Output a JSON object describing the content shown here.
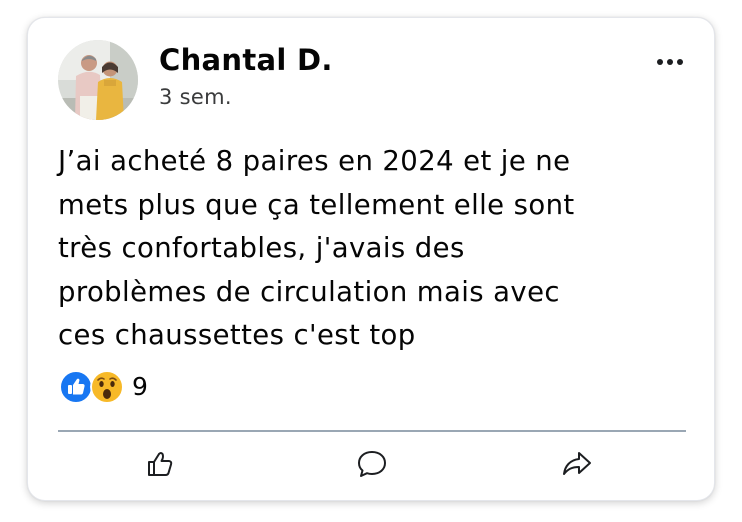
{
  "post": {
    "author_name": "Chantal D.",
    "timestamp": "3 sem.",
    "body": "J’ai acheté 8 paires en 2024 et je ne\nmets plus que ça tellement elle sont\ntrès confortables, j'avais des\nproblèmes de circulation mais avec\nces chaussettes c'est top",
    "reactions": {
      "icons": [
        "like-reaction-icon",
        "wow-reaction-icon"
      ],
      "count": "9"
    },
    "actions": {
      "like_icon": "thumbs-up-icon",
      "comment_icon": "comment-bubble-icon",
      "share_icon": "share-arrow-icon"
    }
  },
  "colors": {
    "like_blue": "#1877f2",
    "wow_yellow": "#f7b928",
    "text": "#050505",
    "secondary_text": "#3a3b3c",
    "divider": "#9aa7b4"
  }
}
